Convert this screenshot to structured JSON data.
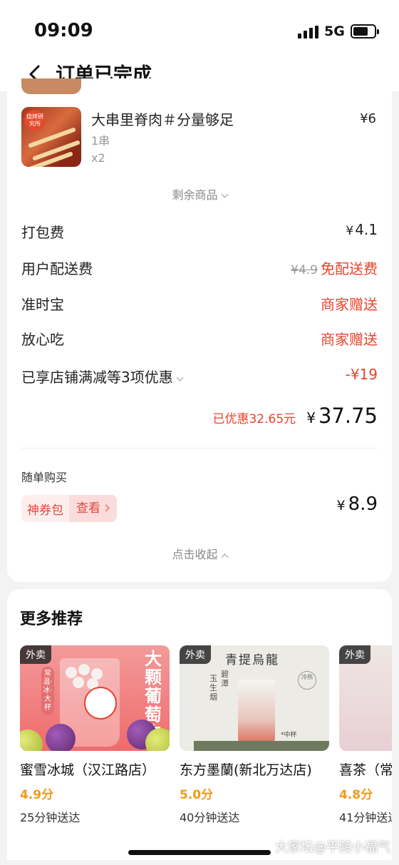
{
  "status_bar": {
    "time": "09:09",
    "network": "5G"
  },
  "nav": {
    "title": "订单已完成",
    "back_icon": "chevron-left-icon"
  },
  "order_item": {
    "name": "大串里脊肉＃分量够足",
    "price": "¥6",
    "spec": "1串",
    "quantity": "x2",
    "thumb_badge": "烧烤研究所"
  },
  "more_items_label": "剩余商品",
  "fees": [
    {
      "label": "打包费",
      "value": "4.1",
      "currency": "¥"
    },
    {
      "label": "用户配送费",
      "original": "¥4.9",
      "value": "免配送费"
    },
    {
      "label": "准时宝",
      "value": "商家赠送"
    },
    {
      "label": "放心吃",
      "value": "商家赠送"
    },
    {
      "label": "已享店铺满减等3项优惠",
      "value": "-¥19"
    }
  ],
  "total": {
    "saved": "已优惠32.65元",
    "currency": "¥",
    "amount": "37.75"
  },
  "extra_purchase": {
    "title": "随单购买",
    "coupon_name": "神券包",
    "view_label": "查看",
    "currency": "¥",
    "price": "8.9"
  },
  "collapse_label": "点击收起",
  "recommendations": {
    "title": "更多推荐",
    "shops": [
      {
        "tag": "外卖",
        "name": "蜜雪冰城（汉江路店）",
        "rating": "4.9分",
        "eta": "25分钟送达",
        "image_text": "大颗葡萄肉",
        "side_text": "常温·冰·大杯"
      },
      {
        "tag": "外卖",
        "name": "东方墨蘭(新北万达店)",
        "rating": "5.0分",
        "eta": "40分钟送达",
        "image_title": "青提烏龍",
        "image_side1": "玉生烟",
        "image_side2": "碧潭",
        "image_stamp": "冷热",
        "image_size": "*中杯"
      },
      {
        "tag": "外卖",
        "name": "喜茶（常",
        "rating": "4.8分",
        "eta": "41分钟送达"
      }
    ]
  },
  "watermark": "大家坛@平陵小福气",
  "colors": {
    "accent_red": "#e8432b",
    "rating_orange": "#f09a1c"
  }
}
